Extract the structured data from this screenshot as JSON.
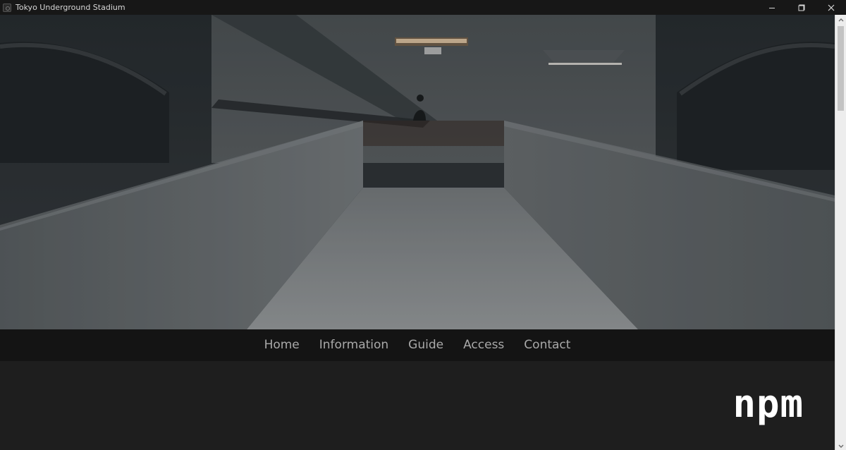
{
  "window": {
    "title": "Tokyo Underground Stadium",
    "controls": {
      "minimize_icon": "minimize-icon",
      "maximize_icon": "restore-icon",
      "close_icon": "close-icon"
    }
  },
  "nav": {
    "items": [
      {
        "label": "Home"
      },
      {
        "label": "Information"
      },
      {
        "label": "Guide"
      },
      {
        "label": "Access"
      },
      {
        "label": "Contact"
      }
    ]
  },
  "content": {
    "logo_text": "npm"
  },
  "colors": {
    "titlebar_bg": "#171717",
    "navbar_bg": "#141414",
    "content_bg": "#1e1e1e",
    "nav_text": "#a9a9a9",
    "logo_text": "#ffffff"
  }
}
